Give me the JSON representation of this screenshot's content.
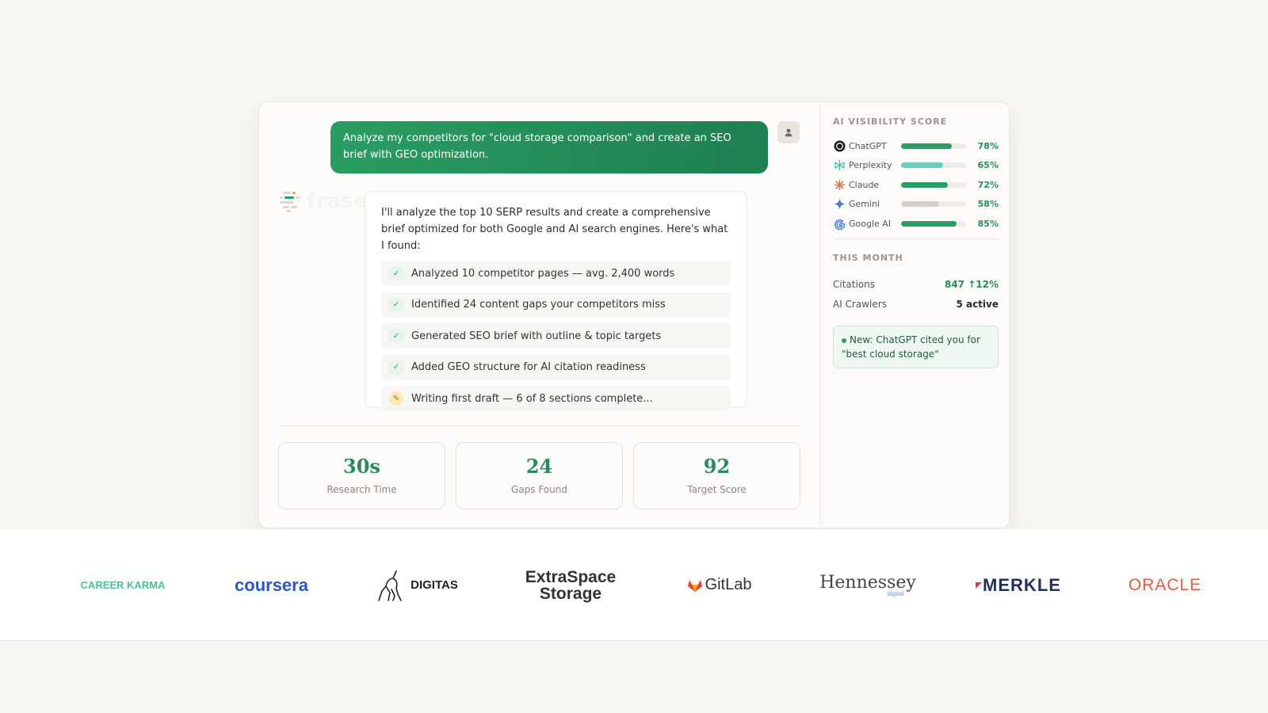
{
  "chat": {
    "user_message": "Analyze my competitors for \"cloud storage comparison\" and create an SEO brief with GEO optimization.",
    "logo_text": "frase",
    "reply_text": "I'll analyze the top 10 SERP results and create a comprehensive brief optimized for both Google and AI search engines. Here's what I found:",
    "steps": [
      {
        "text": "Analyzed 10 competitor pages — avg. 2,400 words",
        "icon": "check-icon",
        "status": "done"
      },
      {
        "text": "Identified 24 content gaps your competitors miss",
        "icon": "check-icon",
        "status": "done"
      },
      {
        "text": "Generated SEO brief with outline & topic targets",
        "icon": "check-icon",
        "status": "done"
      },
      {
        "text": "Added GEO structure for AI citation readiness",
        "icon": "check-icon",
        "status": "done"
      },
      {
        "text": "Writing first draft — 6 of 8 sections complete...",
        "icon": "pen-icon",
        "status": "in-progress"
      }
    ]
  },
  "stats": [
    {
      "value": "30s",
      "label": "Research Time"
    },
    {
      "value": "24",
      "label": "Gaps Found"
    },
    {
      "value": "92",
      "label": "Target Score"
    }
  ],
  "sidebar": {
    "visibility_title": "AI VISIBILITY SCORE",
    "platforms": [
      {
        "name": "ChatGPT",
        "pct": "78%",
        "value": 0.78,
        "color": "#2a9d62",
        "icon": "chatgpt-icon"
      },
      {
        "name": "Perplexity",
        "pct": "65%",
        "value": 0.65,
        "color": "#5fd4c4",
        "icon": "perplexity-icon"
      },
      {
        "name": "Claude",
        "pct": "72%",
        "value": 0.72,
        "color": "#2a9d62",
        "icon": "claude-icon"
      },
      {
        "name": "Gemini",
        "pct": "58%",
        "value": 0.58,
        "color": "#d6cfc4",
        "icon": "gemini-icon"
      },
      {
        "name": "Google AI",
        "pct": "85%",
        "value": 0.85,
        "color": "#2a9d62",
        "icon": "google-icon"
      }
    ],
    "month_title": "THIS MONTH",
    "citations_label": "Citations",
    "citations_value": "847 ↑12%",
    "crawlers_label": "AI Crawlers",
    "crawlers_value": "5 active",
    "alert": "New: ChatGPT cited you for \"best cloud storage\""
  },
  "brands": [
    "CAREER KARMA",
    "coursera",
    "DIGITAS",
    "ExtraSpace Storage",
    "GitLab",
    "Hennessey",
    "MERKLE",
    "ORACLE"
  ],
  "brand_extra": {
    "hennessey_sub": "digital"
  },
  "colors": {
    "accent": "#2a9d62",
    "accent_dark": "#1f7f50",
    "background": "#f8f6f2"
  }
}
